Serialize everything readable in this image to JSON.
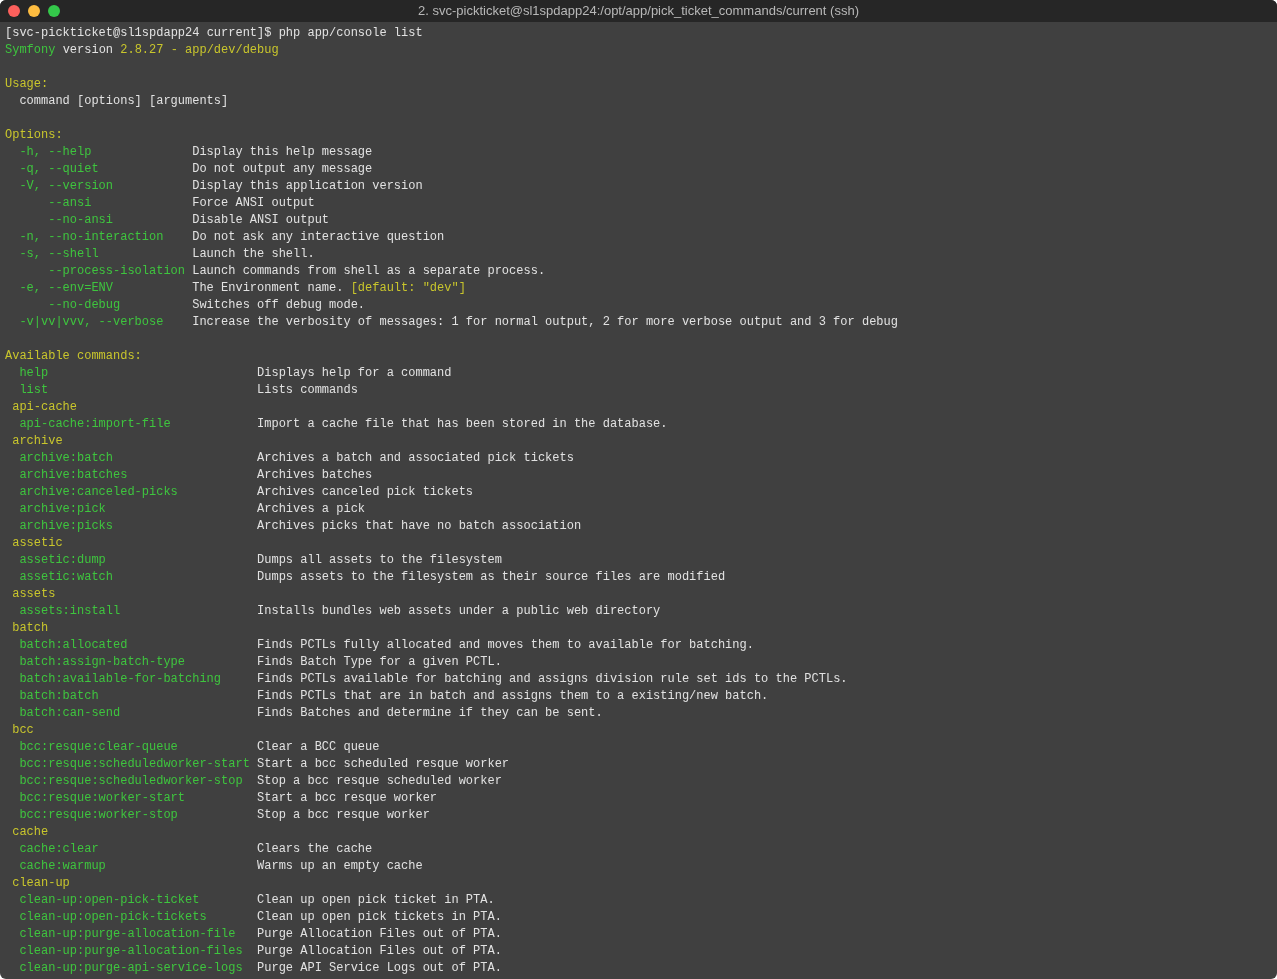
{
  "window": {
    "title": "2. svc-pickticket@sl1spdapp24:/opt/app/pick_ticket_commands/current (ssh)"
  },
  "terminal": {
    "prompt": "[svc-pickticket@sl1spdapp24 current]$ php app/console list",
    "version": {
      "name": "Symfony",
      "label": "version",
      "number": "2.8.27 - app/dev/debug"
    },
    "usage": {
      "heading": "Usage:",
      "line": "command [options] [arguments]"
    },
    "options": {
      "heading": "Options:",
      "items": [
        {
          "kind": "short_and_long",
          "flag": "-h, --help",
          "description": "Display this help message"
        },
        {
          "kind": "short_and_long",
          "flag": "-q, --quiet",
          "description": "Do not output any message"
        },
        {
          "kind": "short_and_long",
          "flag": "-V, --version",
          "description": "Display this application version"
        },
        {
          "kind": "long_only",
          "flag": "--ansi",
          "description": "Force ANSI output"
        },
        {
          "kind": "long_only",
          "flag": "--no-ansi",
          "description": "Disable ANSI output"
        },
        {
          "kind": "short_and_long",
          "flag": "-n, --no-interaction",
          "description": "Do not ask any interactive question"
        },
        {
          "kind": "short_and_long",
          "flag": "-s, --shell",
          "description": "Launch the shell."
        },
        {
          "kind": "long_only",
          "flag": "--process-isolation",
          "description": "Launch commands from shell as a separate process."
        },
        {
          "kind": "short_and_long",
          "flag": "-e, --env=ENV",
          "description": "The Environment name.",
          "default": "[default: \"dev\"]"
        },
        {
          "kind": "long_only",
          "flag": "--no-debug",
          "description": "Switches off debug mode."
        },
        {
          "kind": "short_and_long",
          "flag": "-v|vv|vvv, --verbose",
          "description": "Increase the verbosity of messages: 1 for normal output, 2 for more verbose output and 3 for debug"
        }
      ]
    },
    "commands": {
      "heading": "Available commands:",
      "items": [
        {
          "name": "help",
          "description": "Displays help for a command"
        },
        {
          "name": "list",
          "description": "Lists commands"
        }
      ],
      "namespaces": [
        {
          "name": "api-cache",
          "commands": [
            {
              "name": "api-cache:import-file",
              "description": "Import a cache file that has been stored in the database."
            }
          ]
        },
        {
          "name": "archive",
          "commands": [
            {
              "name": "archive:batch",
              "description": "Archives a batch and associated pick tickets"
            },
            {
              "name": "archive:batches",
              "description": "Archives batches"
            },
            {
              "name": "archive:canceled-picks",
              "description": "Archives canceled pick tickets"
            },
            {
              "name": "archive:pick",
              "description": "Archives a pick"
            },
            {
              "name": "archive:picks",
              "description": "Archives picks that have no batch association"
            }
          ]
        },
        {
          "name": "assetic",
          "commands": [
            {
              "name": "assetic:dump",
              "description": "Dumps all assets to the filesystem"
            },
            {
              "name": "assetic:watch",
              "description": "Dumps assets to the filesystem as their source files are modified"
            }
          ]
        },
        {
          "name": "assets",
          "commands": [
            {
              "name": "assets:install",
              "description": "Installs bundles web assets under a public web directory"
            }
          ]
        },
        {
          "name": "batch",
          "commands": [
            {
              "name": "batch:allocated",
              "description": "Finds PCTLs fully allocated and moves them to available for batching."
            },
            {
              "name": "batch:assign-batch-type",
              "description": "Finds Batch Type for a given PCTL."
            },
            {
              "name": "batch:available-for-batching",
              "description": "Finds PCTLs available for batching and assigns division rule set ids to the PCTLs."
            },
            {
              "name": "batch:batch",
              "description": "Finds PCTLs that are in batch and assigns them to a existing/new batch."
            },
            {
              "name": "batch:can-send",
              "description": "Finds Batches and determine if they can be sent."
            }
          ]
        },
        {
          "name": "bcc",
          "commands": [
            {
              "name": "bcc:resque:clear-queue",
              "description": "Clear a BCC queue"
            },
            {
              "name": "bcc:resque:scheduledworker-start",
              "description": "Start a bcc scheduled resque worker"
            },
            {
              "name": "bcc:resque:scheduledworker-stop",
              "description": "Stop a bcc resque scheduled worker"
            },
            {
              "name": "bcc:resque:worker-start",
              "description": "Start a bcc resque worker"
            },
            {
              "name": "bcc:resque:worker-stop",
              "description": "Stop a bcc resque worker"
            }
          ]
        },
        {
          "name": "cache",
          "commands": [
            {
              "name": "cache:clear",
              "description": "Clears the cache"
            },
            {
              "name": "cache:warmup",
              "description": "Warms up an empty cache"
            }
          ]
        },
        {
          "name": "clean-up",
          "commands": [
            {
              "name": "clean-up:open-pick-ticket",
              "description": "Clean up open pick ticket in PTA."
            },
            {
              "name": "clean-up:open-pick-tickets",
              "description": "Clean up open pick tickets in PTA."
            },
            {
              "name": "clean-up:purge-allocation-file",
              "description": "Purge Allocation Files out of PTA."
            },
            {
              "name": "clean-up:purge-allocation-files",
              "description": "Purge Allocation Files out of PTA."
            },
            {
              "name": "clean-up:purge-api-service-logs",
              "description": "Purge API Service Logs out of PTA."
            }
          ]
        }
      ]
    }
  }
}
